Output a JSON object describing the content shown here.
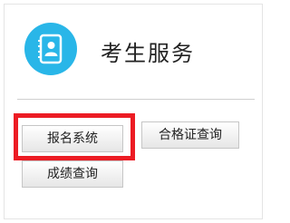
{
  "header": {
    "title": "考生服务",
    "icon": "student-id-card-icon",
    "icon_color": "#29b6e8"
  },
  "buttons": {
    "register_label": "报名系统",
    "certificate_query_label": "合格证查询",
    "score_query_label": "成绩查询"
  },
  "highlight": {
    "color": "#ec1c24",
    "target": "报名系统"
  }
}
